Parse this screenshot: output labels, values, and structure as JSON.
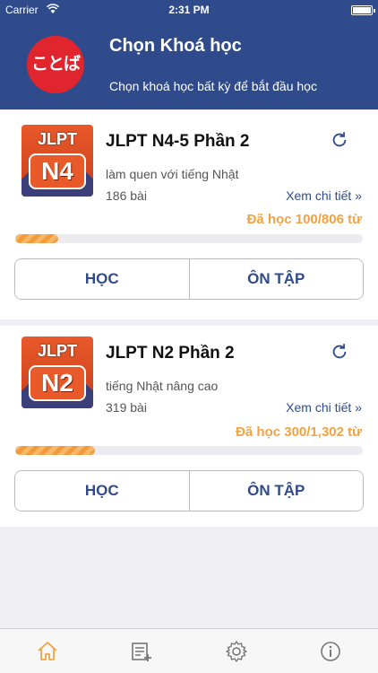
{
  "status": {
    "carrier": "Carrier",
    "time": "2:31 PM"
  },
  "header": {
    "logo_text": "ことば",
    "title": "Chọn Khoá học",
    "subtitle": "Chọn khoá học bất kỳ để bắt đầu học"
  },
  "courses": [
    {
      "title": "JLPT N4-5 Phần 2",
      "thumb_label": "JLPT",
      "thumb_level": "N4",
      "description": "làm quen với tiếng Nhật",
      "count": "186 bài",
      "detail_link": "Xem chi tiết »",
      "progress_text": "Đã học 100/806 từ",
      "progress_fraction": 0.124,
      "learn_label": "HỌC",
      "review_label": "ÔN TẬP"
    },
    {
      "title": "JLPT N2 Phần 2",
      "thumb_label": "JLPT",
      "thumb_level": "N2",
      "description": "tiếng Nhật nâng cao",
      "count": "319 bài",
      "detail_link": "Xem chi tiết »",
      "progress_text": "Đã học 300/1,302 từ",
      "progress_fraction": 0.23,
      "learn_label": "HỌC",
      "review_label": "ÔN TẬP"
    }
  ],
  "tabs": [
    {
      "icon": "home-icon",
      "active": true
    },
    {
      "icon": "add-list-icon",
      "active": false
    },
    {
      "icon": "gear-icon",
      "active": false
    },
    {
      "icon": "info-icon",
      "active": false
    }
  ],
  "colors": {
    "primary": "#2f4b8c",
    "accent": "#f2a341",
    "logo_red": "#e1252f"
  }
}
